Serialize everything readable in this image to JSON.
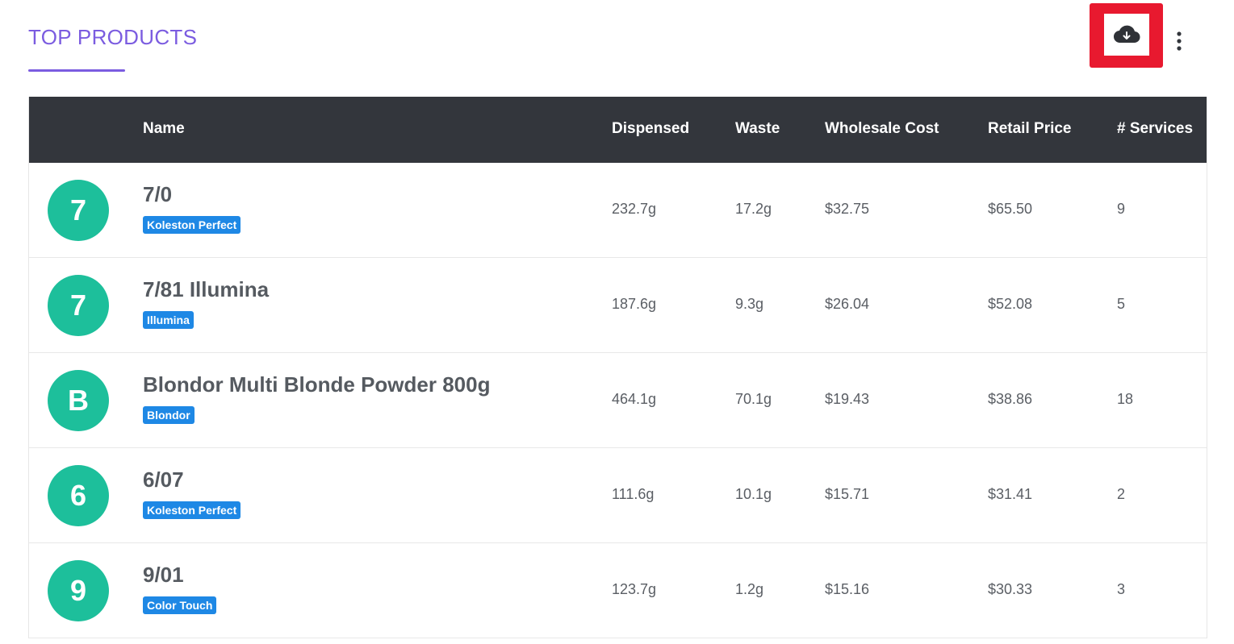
{
  "header": {
    "title": "TOP PRODUCTS",
    "download_icon": "cloud-download-icon",
    "more_icon": "more-vertical-icon",
    "accent_color": "#7b5ce0",
    "highlight_color": "#e8192f"
  },
  "table": {
    "columns": [
      "",
      "Name",
      "Dispensed",
      "Waste",
      "Wholesale Cost",
      "Retail Price",
      "# Services"
    ],
    "rows": [
      {
        "initial": "7",
        "name": "7/0",
        "brand": "Koleston Perfect",
        "dispensed": "232.7g",
        "waste": "17.2g",
        "wholesale": "$32.75",
        "retail": "$65.50",
        "services": "9"
      },
      {
        "initial": "7",
        "name": "7/81 Illumina",
        "brand": "Illumina",
        "dispensed": "187.6g",
        "waste": "9.3g",
        "wholesale": "$26.04",
        "retail": "$52.08",
        "services": "5"
      },
      {
        "initial": "B",
        "name": "Blondor Multi Blonde Powder 800g",
        "brand": "Blondor",
        "dispensed": "464.1g",
        "waste": "70.1g",
        "wholesale": "$19.43",
        "retail": "$38.86",
        "services": "18"
      },
      {
        "initial": "6",
        "name": "6/07",
        "brand": "Koleston Perfect",
        "dispensed": "111.6g",
        "waste": "10.1g",
        "wholesale": "$15.71",
        "retail": "$31.41",
        "services": "2"
      },
      {
        "initial": "9",
        "name": "9/01",
        "brand": "Color Touch",
        "dispensed": "123.7g",
        "waste": "1.2g",
        "wholesale": "$15.16",
        "retail": "$30.33",
        "services": "3"
      }
    ],
    "header_bg": "#33363c",
    "avatar_color": "#1dbf9b",
    "badge_color": "#1e88e5"
  }
}
